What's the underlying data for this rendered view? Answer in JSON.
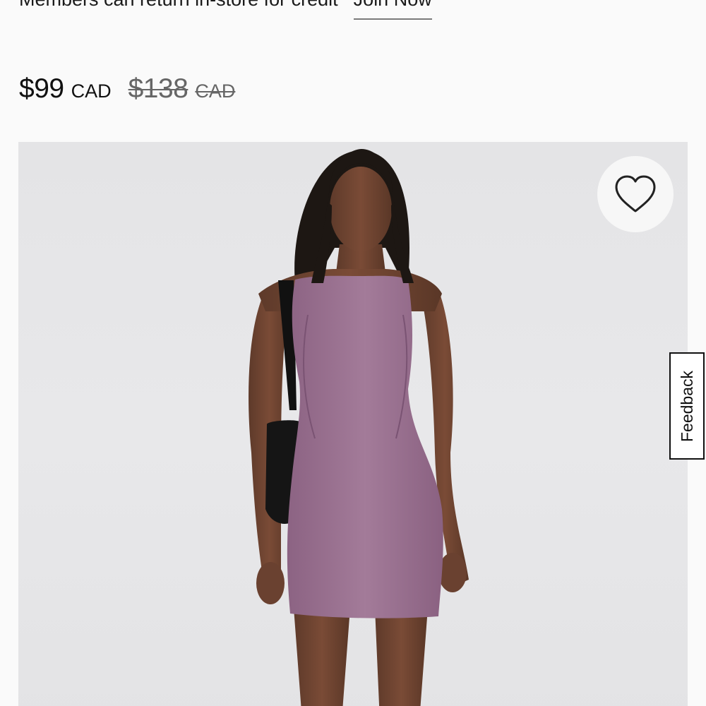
{
  "promo": {
    "text": "Members can return in-store for credit",
    "link_label": "Join Now"
  },
  "price": {
    "sale_amount": "$99",
    "sale_currency": "CAD",
    "original_amount": "$138",
    "original_currency": "CAD"
  },
  "product": {
    "dress_color": "#9a7090"
  },
  "wishlist": {
    "icon": "heart-icon"
  },
  "feedback": {
    "label": "Feedback"
  }
}
